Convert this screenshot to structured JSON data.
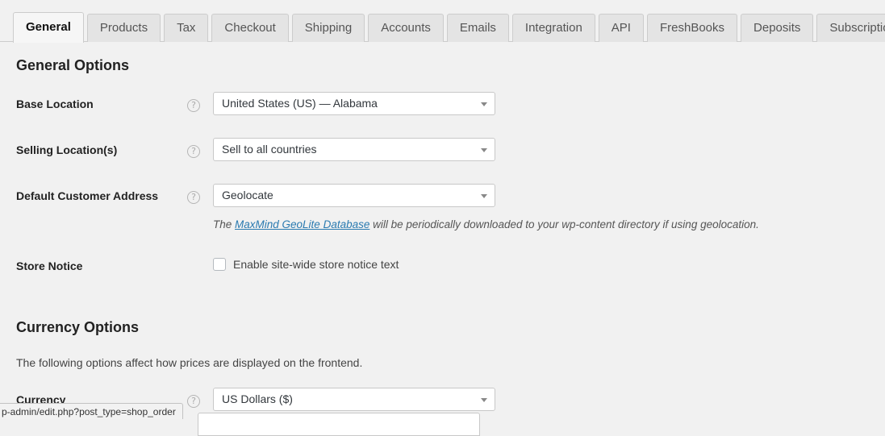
{
  "tabs": [
    {
      "label": "General",
      "active": true
    },
    {
      "label": "Products",
      "active": false
    },
    {
      "label": "Tax",
      "active": false
    },
    {
      "label": "Checkout",
      "active": false
    },
    {
      "label": "Shipping",
      "active": false
    },
    {
      "label": "Accounts",
      "active": false
    },
    {
      "label": "Emails",
      "active": false
    },
    {
      "label": "Integration",
      "active": false
    },
    {
      "label": "API",
      "active": false
    },
    {
      "label": "FreshBooks",
      "active": false
    },
    {
      "label": "Deposits",
      "active": false
    },
    {
      "label": "Subscriptions",
      "active": false
    }
  ],
  "general": {
    "title": "General Options",
    "rows": {
      "base_location": {
        "label": "Base Location",
        "help": "?",
        "value": "United States (US) — Alabama"
      },
      "selling_location": {
        "label": "Selling Location(s)",
        "help": "?",
        "value": "Sell to all countries"
      },
      "default_customer_address": {
        "label": "Default Customer Address",
        "help": "?",
        "value": "Geolocate",
        "desc_before": "The ",
        "desc_link": "MaxMind GeoLite Database",
        "desc_after": " will be periodically downloaded to your wp-content directory if using geolocation."
      },
      "store_notice": {
        "label": "Store Notice",
        "checkbox_label": "Enable site-wide store notice text",
        "checked": false
      }
    }
  },
  "currency": {
    "title": "Currency Options",
    "description": "The following options affect how prices are displayed on the frontend.",
    "rows": {
      "currency": {
        "label": "Currency",
        "help": "?",
        "value": "US Dollars ($)"
      }
    }
  },
  "status_bar": {
    "url": "p-admin/edit.php?post_type=shop_order"
  },
  "colors": {
    "page_background": "#f1f1f1",
    "tab_inactive": "#e4e4e4",
    "tab_active": "#f6f6f6",
    "border": "#cccccc",
    "link": "#2a7ab0",
    "label_text": "#222222",
    "body_text": "#444444"
  }
}
